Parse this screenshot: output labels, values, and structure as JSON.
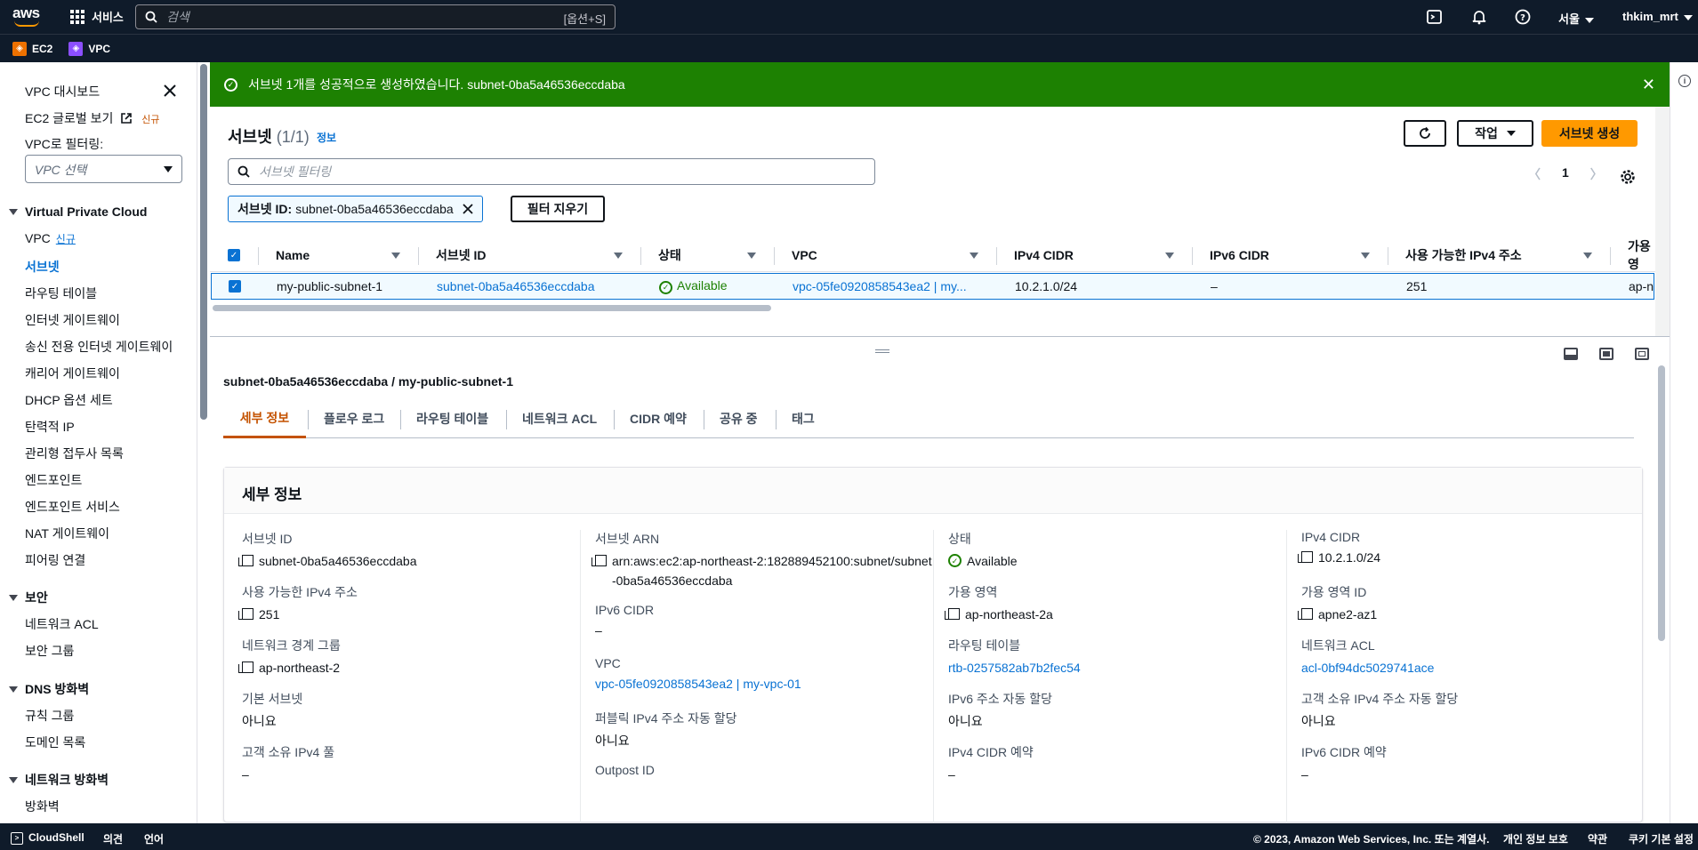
{
  "topnav": {
    "logo": "aws",
    "services": "서비스",
    "search_placeholder": "검색",
    "search_shortcut": "[옵션+S]",
    "region": "서울",
    "user": "thkim_mrt"
  },
  "favorites": [
    {
      "label": "EC2",
      "color": "#ed7100"
    },
    {
      "label": "VPC",
      "color": "#8c4fff"
    }
  ],
  "sidebar": {
    "dashboard": "VPC 대시보드",
    "ec2_global": "EC2 글로벌 보기",
    "new_badge": "신규",
    "filter_label": "VPC로 필터링:",
    "vpc_select_placeholder": "VPC 선택",
    "sections": [
      {
        "title": "Virtual Private Cloud",
        "items": [
          "VPC",
          "서브넷",
          "라우팅 테이블",
          "인터넷 게이트웨이",
          "송신 전용 인터넷 게이트웨이",
          "캐리어 게이트웨이",
          "DHCP 옵션 세트",
          "탄력적 IP",
          "관리형 접두사 목록",
          "엔드포인트",
          "엔드포인트 서비스",
          "NAT 게이트웨이",
          "피어링 연결"
        ]
      },
      {
        "title": "보안",
        "items": [
          "네트워크 ACL",
          "보안 그룹"
        ]
      },
      {
        "title": "DNS 방화벽",
        "items": [
          "규칙 그룹",
          "도메인 목록"
        ]
      },
      {
        "title": "네트워크 방화벽",
        "items": [
          "방화벽"
        ]
      }
    ],
    "vpc_new": "신규"
  },
  "flash": {
    "message": "서브넷 1개를 성공적으로 생성하였습니다. subnet-0ba5a46536eccdaba"
  },
  "table": {
    "title": "서브넷",
    "count": "(1/1)",
    "info": "정보",
    "actions_label": "작업",
    "create_label": "서브넷 생성",
    "filter_placeholder": "서브넷 필터링",
    "token_key": "서브넷 ID:",
    "token_value": "subnet-0ba5a46536eccdaba",
    "clear_filters": "필터 지우기",
    "page": "1",
    "columns": [
      "Name",
      "서브넷 ID",
      "상태",
      "VPC",
      "IPv4 CIDR",
      "IPv6 CIDR",
      "사용 가능한 IPv4 주소",
      "가용 영"
    ],
    "row": {
      "name": "my-public-subnet-1",
      "subnet_id": "subnet-0ba5a46536eccdaba",
      "status": "Available",
      "vpc": "vpc-05fe0920858543ea2 | my...",
      "ipv4_cidr": "10.2.1.0/24",
      "ipv6_cidr": "–",
      "available_ipv4": "251",
      "az": "ap-no"
    }
  },
  "details": {
    "title": "subnet-0ba5a46536eccdaba / my-public-subnet-1",
    "tabs": [
      "세부 정보",
      "플로우 로그",
      "라우팅 테이블",
      "네트워크 ACL",
      "CIDR 예약",
      "공유 중",
      "태그"
    ],
    "box_title": "세부 정보",
    "col1": [
      {
        "k": "서브넷 ID",
        "v": "subnet-0ba5a46536eccdaba"
      },
      {
        "k": "사용 가능한 IPv4 주소",
        "v": "251"
      },
      {
        "k": "네트워크 경계 그룹",
        "v": "ap-northeast-2"
      },
      {
        "k": "기본 서브넷",
        "v": "아니요"
      },
      {
        "k": "고객 소유 IPv4 풀",
        "v": "–"
      }
    ],
    "col2": [
      {
        "k": "서브넷 ARN",
        "v": "arn:aws:ec2:ap-northeast-2:182889452100:subnet/subnet-0ba5a46536eccdaba"
      },
      {
        "k": "IPv6 CIDR",
        "v": "–"
      },
      {
        "k": "VPC",
        "v": "vpc-05fe0920858543ea2 | my-vpc-01"
      },
      {
        "k": "퍼블릭 IPv4 주소 자동 할당",
        "v": "아니요"
      },
      {
        "k": "Outpost ID",
        "v": ""
      }
    ],
    "col3": [
      {
        "k": "상태",
        "v": "Available"
      },
      {
        "k": "가용 영역",
        "v": "ap-northeast-2a"
      },
      {
        "k": "라우팅 테이블",
        "v": "rtb-0257582ab7b2fec54"
      },
      {
        "k": "IPv6 주소 자동 할당",
        "v": "아니요"
      },
      {
        "k": "IPv4 CIDR 예약",
        "v": "–"
      }
    ],
    "col4": [
      {
        "k": "IPv4 CIDR",
        "v": "10.2.1.0/24"
      },
      {
        "k": "가용 영역 ID",
        "v": "apne2-az1"
      },
      {
        "k": "네트워크 ACL",
        "v": "acl-0bf94dc5029741ace"
      },
      {
        "k": "고객 소유 IPv4 주소 자동 할당",
        "v": "아니요"
      },
      {
        "k": "IPv6 CIDR 예약",
        "v": "–"
      }
    ]
  },
  "footer": {
    "cloudshell": "CloudShell",
    "feedback": "의견",
    "language": "언어",
    "copyright": "© 2023, Amazon Web Services, Inc. 또는 계열사.",
    "privacy": "개인 정보 보호",
    "terms": "약관",
    "cookies": "쿠키 기본 설정"
  },
  "colors": {
    "nav": "#0f1b2a",
    "success": "#1d8102",
    "link": "#0972d3",
    "primary": "#ff9900",
    "active_tab": "#c45200"
  }
}
